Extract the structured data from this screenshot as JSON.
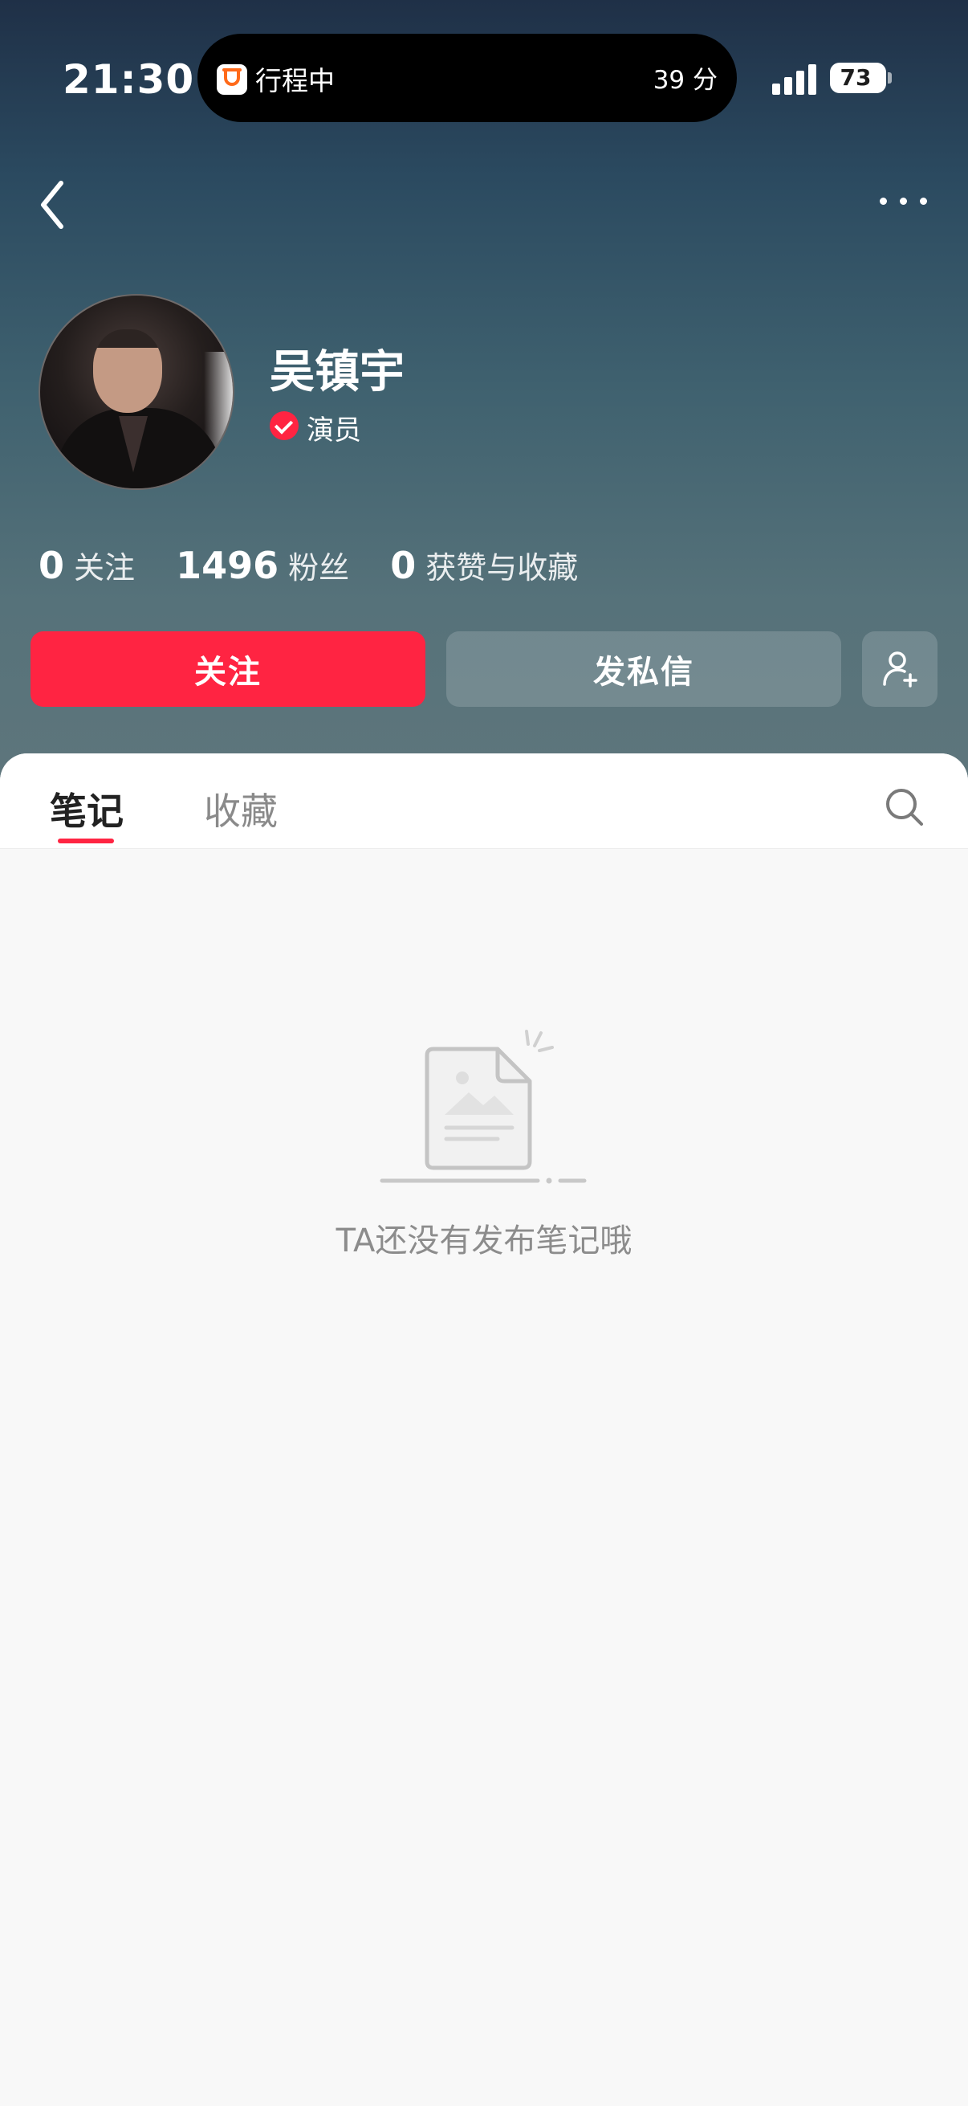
{
  "status_bar": {
    "time": "21:30",
    "activity_label": "行程中",
    "activity_eta": "39 分",
    "battery": "73",
    "icons": [
      "cup-app-icon",
      "signal-icon",
      "battery-icon"
    ]
  },
  "nav": {
    "back_icon": "chevron-left-icon",
    "more_icon": "more-dots-icon"
  },
  "profile": {
    "name": "吴镇宇",
    "role": "演员",
    "verified_icon": "verified-check-icon",
    "avatar": "avatar-photo"
  },
  "stats": [
    {
      "value": "0",
      "label": "关注"
    },
    {
      "value": "1496",
      "label": "粉丝"
    },
    {
      "value": "0",
      "label": "获赞与收藏"
    }
  ],
  "actions": {
    "follow_label": "关注",
    "message_label": "发私信",
    "add_friend_icon": "add-user-icon"
  },
  "tabs": [
    {
      "label": "笔记",
      "active": true
    },
    {
      "label": "收藏",
      "active": false
    }
  ],
  "empty_state": {
    "text": "TA还没有发布笔记哦",
    "icon": "empty-document-icon"
  },
  "colors": {
    "accent": "#ff2442",
    "header_top": "#1f3047",
    "header_bottom": "#5f767c",
    "background": "#f8f8f8"
  }
}
